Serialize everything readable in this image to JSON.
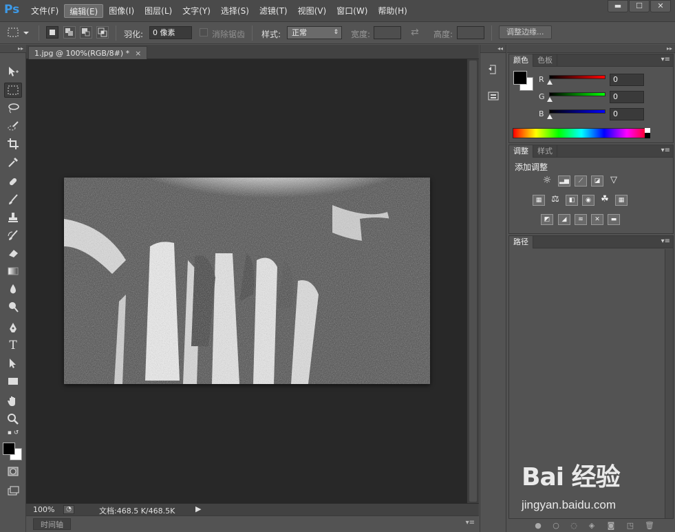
{
  "app": {
    "logo": "Ps"
  },
  "menu": [
    "文件(F)",
    "编辑(E)",
    "图像(I)",
    "图层(L)",
    "文字(Y)",
    "选择(S)",
    "滤镜(T)",
    "视图(V)",
    "窗口(W)",
    "帮助(H)"
  ],
  "menu_active": "编辑(E)",
  "window_controls": {
    "minimize": "▬",
    "maximize": "☐",
    "close": "✕"
  },
  "options": {
    "feather_label": "羽化:",
    "feather_value": "0 像素",
    "antialias_label": "消除锯齿",
    "style_label": "样式:",
    "style_value": "正常",
    "width_label": "宽度:",
    "height_label": "高度:",
    "refine_edge": "调整边缘..."
  },
  "document": {
    "tab_title": "1.jpg @ 100%(RGB/8#) *",
    "tab_close": "×",
    "zoom": "100%",
    "doc_info": "文档:468.5 K/468.5K"
  },
  "timeline": {
    "label": "时间轴"
  },
  "color_panel": {
    "tabs": [
      "颜色",
      "色板"
    ],
    "active_tab": "颜色",
    "r_label": "R",
    "r_value": "0",
    "g_label": "G",
    "g_value": "0",
    "b_label": "B",
    "b_value": "0",
    "foreground": "#000000",
    "background": "#ffffff"
  },
  "adjust_panel": {
    "tabs": [
      "调整",
      "样式"
    ],
    "active_tab": "调整",
    "title": "添加调整"
  },
  "paths_panel": {
    "tab": "路径"
  },
  "watermark": {
    "brand": "Bai 经验",
    "url": "jingyan.baidu.com"
  }
}
